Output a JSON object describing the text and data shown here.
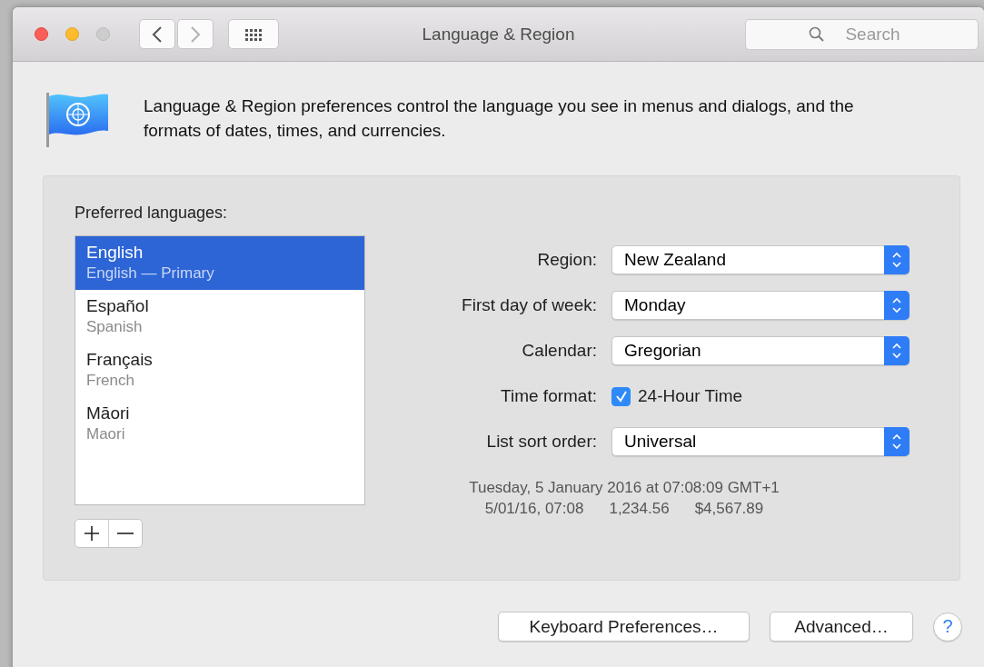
{
  "window": {
    "title": "Language & Region"
  },
  "toolbar": {
    "search": {
      "placeholder": "Search"
    }
  },
  "description": "Language & Region preferences control the language you see in menus and dialogs, and the formats of dates, times, and currencies.",
  "languages": {
    "label": "Preferred languages:",
    "items": [
      {
        "name": "English",
        "subtitle": "English — Primary",
        "selected": true
      },
      {
        "name": "Español",
        "subtitle": "Spanish",
        "selected": false
      },
      {
        "name": "Français",
        "subtitle": "French",
        "selected": false
      },
      {
        "name": "Māori",
        "subtitle": "Maori",
        "selected": false
      }
    ]
  },
  "settings": [
    {
      "kind": "popup",
      "label": "Region:",
      "value": "New Zealand"
    },
    {
      "kind": "popup",
      "label": "First day of week:",
      "value": "Monday"
    },
    {
      "kind": "popup",
      "label": "Calendar:",
      "value": "Gregorian"
    },
    {
      "kind": "checkbox",
      "label": "Time format:",
      "text": "24-Hour Time",
      "checked": true
    },
    {
      "kind": "popup",
      "label": "List sort order:",
      "value": "Universal"
    }
  ],
  "sample": {
    "long_date": "Tuesday, 5 January 2016 at 07:08:09 GMT+1",
    "short_date": "5/01/16, 07:08",
    "number": "1,234.56",
    "currency": "$4,567.89"
  },
  "buttons": [
    {
      "label": "Keyboard Preferences…"
    },
    {
      "label": "Advanced…"
    }
  ],
  "help": {
    "label": "?"
  }
}
